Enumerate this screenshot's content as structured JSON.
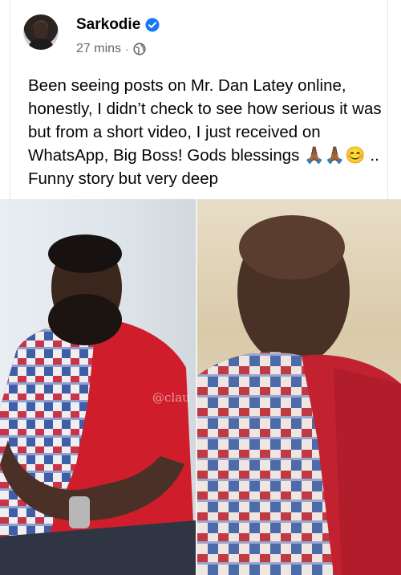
{
  "post": {
    "author_name": "Sarkodie",
    "timestamp": "27 mins",
    "separator": "·",
    "text": "Been seeing posts on Mr. Dan Latey online, honestly, I didn’t check to see how serious it was but from a short video, I just received on WhatsApp, Big Boss! Gods blessings 🙏🏾🙏🏾😊 .. Funny story but very deep"
  },
  "photo": {
    "watermark": "@clau"
  },
  "icons": {
    "verified": "verified-badge-icon",
    "audience": "globe-icon"
  },
  "colors": {
    "verified_blue": "#1877f2",
    "meta_gray": "#65676b",
    "text": "#050505"
  }
}
